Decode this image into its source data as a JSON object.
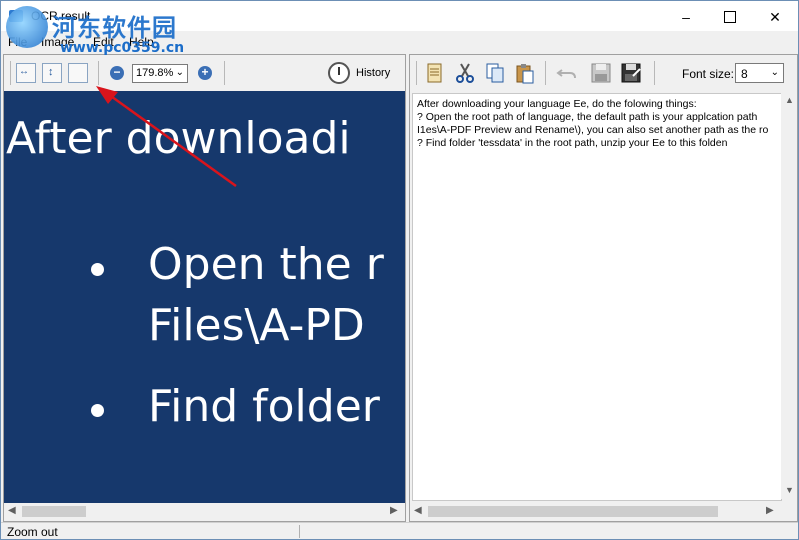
{
  "window": {
    "title": "OCR result",
    "watermark": "河东软件园",
    "watermark_url": "www.pc0359.cn"
  },
  "menu": [
    "File",
    "Image",
    "Edit",
    "Help"
  ],
  "image_toolbar": {
    "zoom_value": "179.8%",
    "history_label": "History"
  },
  "image_preview": {
    "line1": "After downloadi",
    "bullet1_line1": "Open the r",
    "bullet1_line2": "Files\\A-PD",
    "bullet2": "Find folder"
  },
  "text_toolbar": {
    "font_size_label": "Font size:",
    "font_size_value": "8"
  },
  "ocr_text": [
    "After downloading your language Ee, do the folowing things:",
    "? Open the root path of language, the default path is your applcation path",
    "I1es\\A-PDF Preview and Rename\\), you can also set another path as the ro",
    "? Find folder 'tessdata' in the root path, unzip your Ee to this folden"
  ],
  "status": {
    "text": "Zoom out"
  },
  "colors": {
    "image_background": "#16386c",
    "annotation_arrow": "#d9141c",
    "watermark": "#1b6dc9"
  }
}
